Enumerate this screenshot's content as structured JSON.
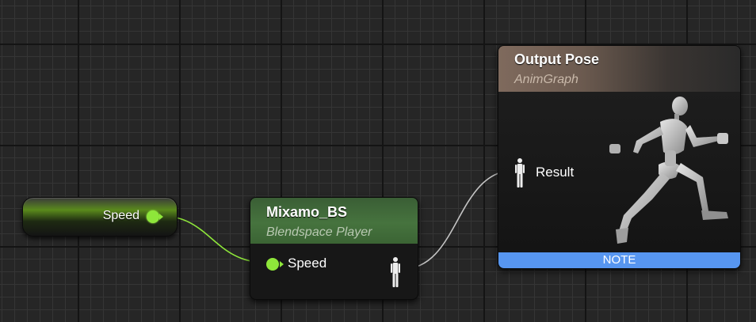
{
  "variable_node": {
    "label": "Speed"
  },
  "blendspace_node": {
    "title": "Mixamo_BS",
    "subtitle": "Blendspace Player",
    "input_pin_label": "Speed"
  },
  "output_node": {
    "title": "Output Pose",
    "subtitle": "AnimGraph",
    "input_pin_label": "Result",
    "note_label": "NOTE"
  },
  "colors": {
    "float_pin": "#8ee63a",
    "blendspace_header": "#46733e",
    "output_header": "#7f6a5d",
    "note_bar": "#5796f0",
    "graph_background": "#262626"
  },
  "icons": {
    "pose_pin": "pose-pin-icon",
    "preview": "mannequin-running-icon"
  }
}
